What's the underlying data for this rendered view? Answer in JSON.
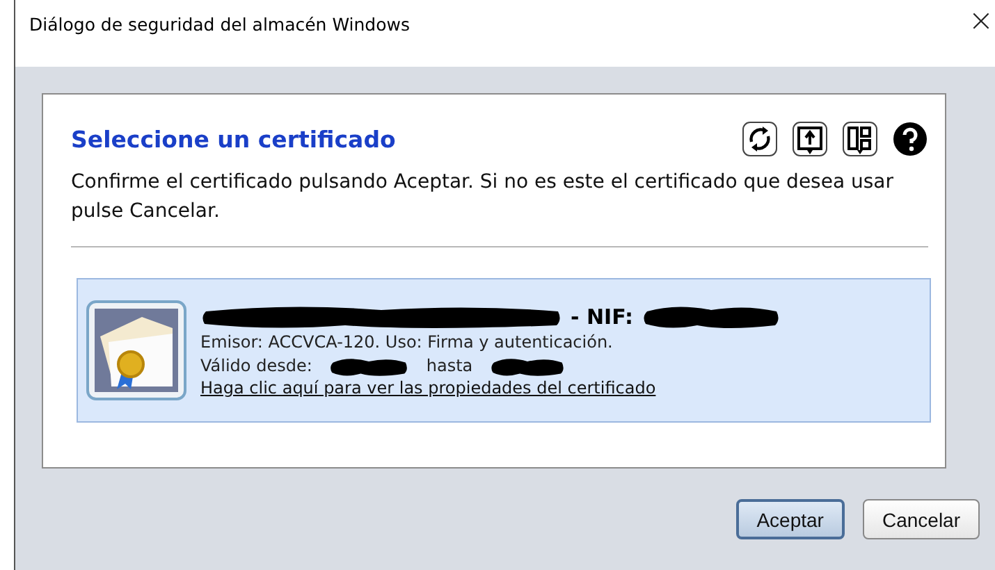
{
  "window": {
    "title": "Diálogo de seguridad del almacén Windows",
    "close": "×"
  },
  "panel": {
    "heading": "Seleccione un certificado",
    "toolbar": [
      {
        "kind": "refresh"
      },
      {
        "kind": "import"
      },
      {
        "kind": "layout"
      },
      {
        "kind": "help"
      }
    ],
    "instructions": "Confirme el certificado pulsando Aceptar. Si no es este el certificado que desea usar pulse Cancelar."
  },
  "certificate": {
    "selected": true,
    "subject": [
      {
        "kind": "redacted"
      },
      {
        "kind": "text",
        "text": "- NIF:"
      },
      {
        "kind": "redacted"
      }
    ],
    "issuer": "Emisor: ACCVCA-120. Uso: Firma y autenticación.",
    "validity": [
      {
        "kind": "text",
        "text": "Válido desde:"
      },
      {
        "kind": "redacted"
      },
      {
        "kind": "text",
        "text": "hasta"
      },
      {
        "kind": "redacted"
      }
    ],
    "link": "Haga clic aquí para ver las propiedades del certificado"
  },
  "buttons": [
    {
      "label": "Aceptar",
      "default": true
    },
    {
      "label": "Cancelar",
      "default": false
    }
  ]
}
